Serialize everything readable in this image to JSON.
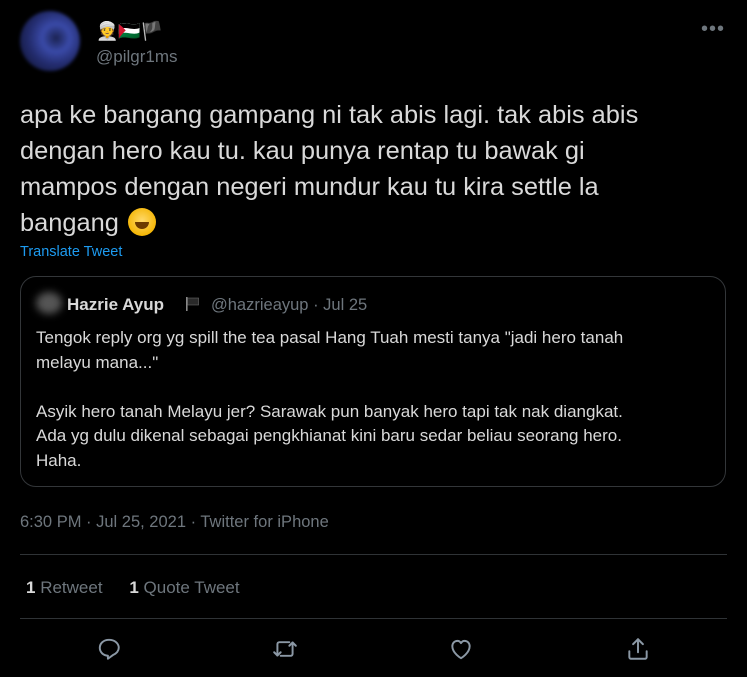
{
  "author": {
    "display_name_emojis": "👳🇵🇸🏴",
    "handle": "@pilgr1ms"
  },
  "tweet": {
    "text": "apa ke bangang gampang ni tak abis lagi. tak abis abis\ndengan hero kau tu. kau punya rentap tu bawak gi\nmampos dengan negeri mundur kau tu kira settle la\nbangang",
    "emoji": "rolling-on-floor-laughing",
    "translate_label": "Translate Tweet"
  },
  "quoted_tweet": {
    "name": "Hazrie Ayup",
    "handle": "@hazrieayup",
    "separator": "·",
    "date": "Jul 25",
    "text": "Tengok reply org yg spill the tea pasal Hang Tuah mesti tanya \"jadi hero tanah\nmelayu mana...\"\n\nAsyik hero tanah Melayu jer? Sarawak pun banyak hero tapi tak nak diangkat.\nAda yg dulu dikenal sebagai pengkhianat kini baru sedar beliau seorang hero.\nHaha."
  },
  "timestamp": "6:30 PM · Jul 25, 2021 · Twitter for iPhone",
  "stats": {
    "retweets_count": "1",
    "retweets_label": "Retweet",
    "quotes_count": "1",
    "quotes_label": "Quote Tweet"
  },
  "actions": [
    "reply-icon",
    "retweet-icon",
    "like-icon",
    "share-icon"
  ],
  "colors": {
    "background": "#000000",
    "text": "#d9d9d9",
    "secondary": "#6e767d",
    "link": "#1d9bf0",
    "border": "#333639"
  }
}
